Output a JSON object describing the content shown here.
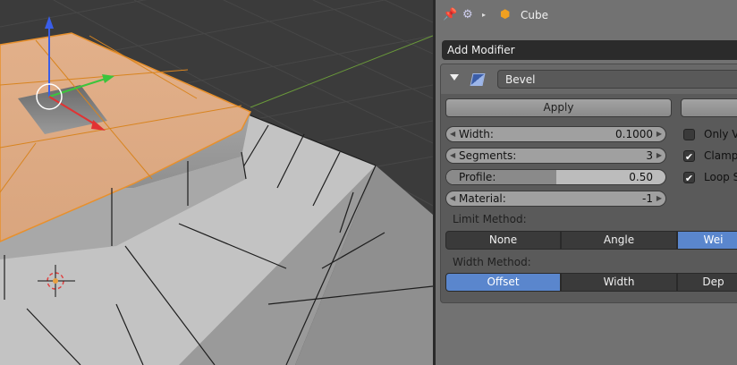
{
  "header": {
    "pin_icon": "pin-icon",
    "scene_icon": "scene-icon",
    "object_icon": "cube-object-icon",
    "object_name": "Cube"
  },
  "add_modifier": {
    "label": "Add Modifier"
  },
  "modifier": {
    "name": "Bevel",
    "icon": "bevel-modifier-icon",
    "apply_label": "Apply",
    "fields": {
      "width": {
        "label": "Width:",
        "value": "0.1000"
      },
      "segments": {
        "label": "Segments:",
        "value": "3"
      },
      "profile": {
        "label": "Profile:",
        "value": "0.50",
        "fraction": 0.5
      },
      "material": {
        "label": "Material:",
        "value": "-1"
      }
    },
    "checkboxes": [
      {
        "label": "Only V",
        "checked": false
      },
      {
        "label": "Clamp",
        "checked": true
      },
      {
        "label": "Loop S",
        "checked": true
      }
    ],
    "limit_method": {
      "label": "Limit Method:",
      "options": [
        "None",
        "Angle",
        "Wei"
      ],
      "selected": "Wei"
    },
    "width_method": {
      "label": "Width Method:",
      "options": [
        "Offset",
        "Width",
        "Dep"
      ],
      "selected": "Offset"
    }
  },
  "colors": {
    "selection_orange": "#e8902c",
    "active_blue": "#5a86cd"
  }
}
